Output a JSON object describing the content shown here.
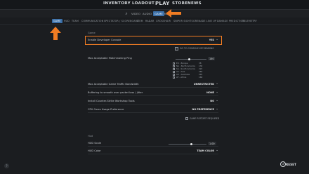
{
  "topnav": {
    "inventory": "INVENTORY",
    "loadout": "LOADOUT",
    "play": "PLAY",
    "store": "STORE",
    "news": "NEWS"
  },
  "subtabs": [
    {
      "label": "GAME",
      "active": false
    },
    {
      "label": "VIDEO",
      "active": false
    },
    {
      "label": "AUDIO",
      "active": false
    },
    {
      "label": "GAME",
      "active": true
    },
    {
      "label": "KB",
      "active": false
    }
  ],
  "cattabs": [
    {
      "label": "GAME",
      "active": true
    },
    {
      "label": "HUD",
      "active": false
    },
    {
      "label": "TEAM",
      "active": false
    },
    {
      "label": "COMMUNICATION",
      "active": false
    },
    {
      "label": "SPECTATOR / SCOREBOARD",
      "active": false
    },
    {
      "label": "ITEM",
      "active": false
    },
    {
      "label": "RADAR",
      "active": false
    },
    {
      "label": "CROSSHAIR",
      "active": false
    },
    {
      "label": "SNIPER SIGHTS",
      "active": false
    },
    {
      "label": "GRENADE LINE UP",
      "active": false
    },
    {
      "label": "DAMAGE PREDICTION",
      "active": false
    },
    {
      "label": "TELEMETRY",
      "active": false
    }
  ],
  "sections": {
    "game_title": "Game",
    "hud_title": "Hud"
  },
  "settings": {
    "dev_console": {
      "label": "Enable Developer Console",
      "value": "YES"
    },
    "console_key": {
      "label": "GO TO CONSOLE KEY BINDING"
    },
    "max_ping": {
      "label": "Max Acceptable Matchmaking Ping",
      "value": "150"
    },
    "ping_regions": [
      {
        "name": "EU - Europe",
        "ping": "38"
      },
      {
        "name": "NA - North America",
        "ping": "130"
      },
      {
        "name": "SA - South America",
        "ping": "222"
      },
      {
        "name": "AS - Asia",
        "ping": "284"
      },
      {
        "name": "AU - Australia",
        "ping": "291"
      },
      {
        "name": "AF - Africa",
        "ping": "160"
      }
    ],
    "bandwidth": {
      "label": "Max Acceptable Game Traffic Bandwidth",
      "value": "UNRESTRICTED"
    },
    "buffering": {
      "label": "Buffering to smooth over packet loss / jitter",
      "value": "NONE"
    },
    "workshop": {
      "label": "Install Counter-Strike Workshop Tools",
      "value": "NO"
    },
    "cpu": {
      "label": "CPU Cores Usage Preference",
      "value": "NO PREFERENCE"
    },
    "restart_note": "GAME RESTART REQUIRED",
    "hud_scale": {
      "label": "HUD Scale",
      "value": "1.00",
      "fraction": 0.6
    },
    "hud_color": {
      "label": "HUD Color",
      "value": "TEAM COLOR"
    }
  },
  "footer": {
    "reset_label": "RESET"
  },
  "colors": {
    "accent": "#f07c23",
    "active_tab": "#3a6fa8",
    "background": "#1b1d20"
  },
  "icons": {
    "search": "search-icon",
    "reset": "reset-icon"
  }
}
